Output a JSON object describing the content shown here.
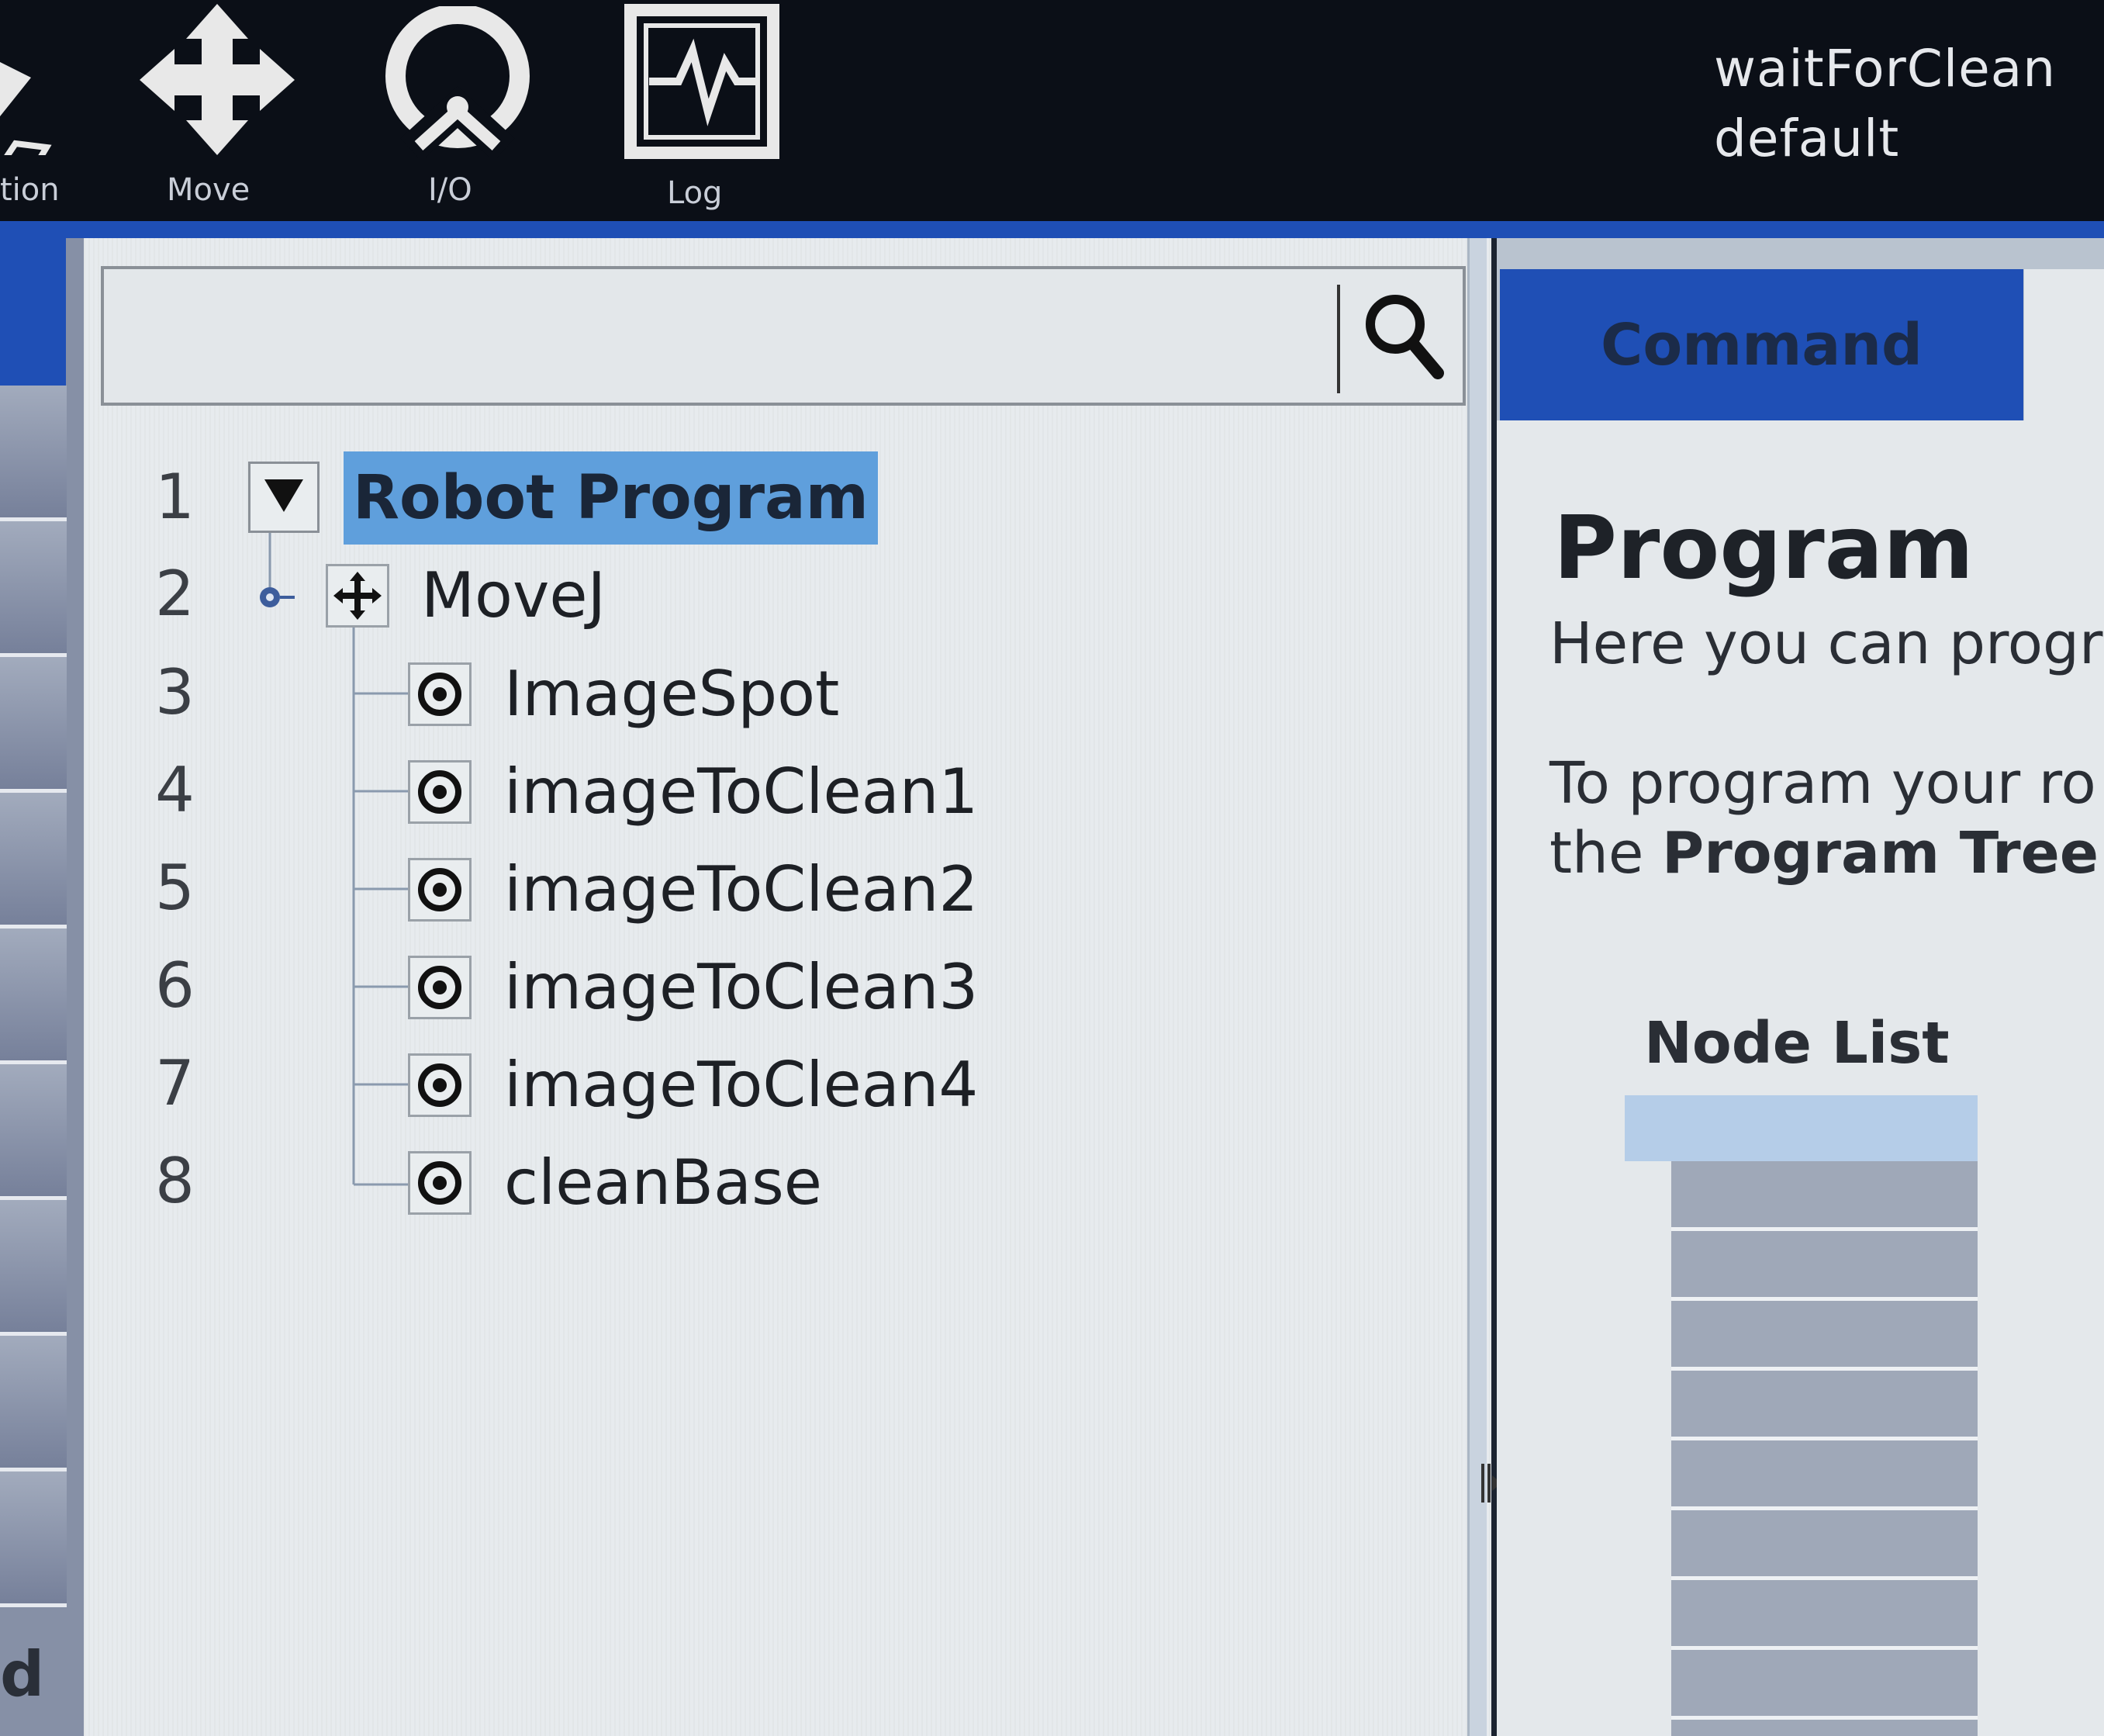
{
  "toolbar": {
    "items": [
      {
        "label": "tion",
        "icon": "installation-icon"
      },
      {
        "label": "Move",
        "icon": "move-arrows-icon"
      },
      {
        "label": "I/O",
        "icon": "io-icon"
      },
      {
        "label": "Log",
        "icon": "log-icon"
      }
    ]
  },
  "status": {
    "program_name": "waitForClean",
    "installation": "default"
  },
  "sidebar": {
    "bottom_letter": "d"
  },
  "search": {
    "value": "",
    "placeholder": "",
    "icon": "search-icon"
  },
  "program_tree": {
    "root": {
      "line": "1",
      "label": "Robot Program"
    },
    "rows": [
      {
        "line": "2",
        "label": "MoveJ",
        "icon": "move-node-icon"
      },
      {
        "line": "3",
        "label": "ImageSpot",
        "icon": "waypoint-icon"
      },
      {
        "line": "4",
        "label": "imageToClean1",
        "icon": "waypoint-icon"
      },
      {
        "line": "5",
        "label": "imageToClean2",
        "icon": "waypoint-icon"
      },
      {
        "line": "6",
        "label": "imageToClean3",
        "icon": "waypoint-icon"
      },
      {
        "line": "7",
        "label": "imageToClean4",
        "icon": "waypoint-icon"
      },
      {
        "line": "8",
        "label": "cleanBase",
        "icon": "waypoint-icon"
      }
    ]
  },
  "right_panel": {
    "tab": "Command",
    "title": "Program",
    "text1": "Here you can progr",
    "text2": "To program your ro",
    "text3_prefix": "the ",
    "text3_bold": "Program Tree",
    "node_list_title": "Node List"
  },
  "colors": {
    "accent_blue": "#1f4fb5",
    "selection": "#5f9fdc",
    "topbar": "#0b0f17"
  }
}
